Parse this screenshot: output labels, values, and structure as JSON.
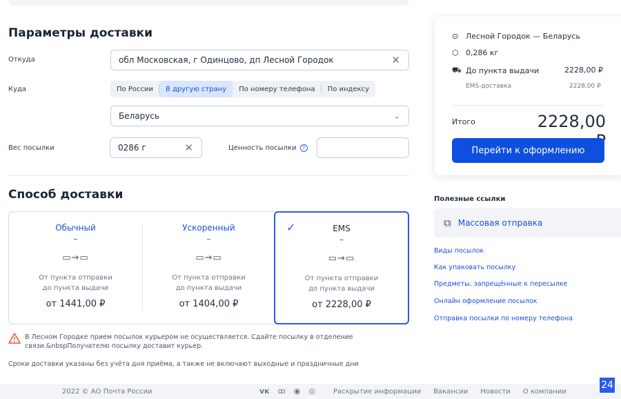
{
  "delivery_params": {
    "title": "Параметры доставки",
    "from_label": "Откуда",
    "from_value": "обл Московская, г Одинцово, дп Лесной Городок",
    "to_label": "Куда",
    "to_options": [
      "По России",
      "В другую страну",
      "По номеру телефона",
      "По индексу"
    ],
    "to_selected": "В другую страну",
    "country": "Беларусь",
    "weight_label": "Вес посылки",
    "weight_value": "0286 г",
    "value_label": "Ценность посылки",
    "value_value": ""
  },
  "method": {
    "title": "Способ доставки",
    "options": [
      {
        "name": "Обычный",
        "dash": "–",
        "route": "▭→▭",
        "desc1": "От пункта отправки",
        "desc2": "до пункта выдачи",
        "price": "от 1441,00 ₽"
      },
      {
        "name": "Ускоренный",
        "dash": "–",
        "route": "▭→▭",
        "desc1": "От пункта отправки",
        "desc2": "до пункта выдачи",
        "price": "от 1404,00 ₽"
      },
      {
        "name": "EMS",
        "dash": "–",
        "route": "▭→▭",
        "desc1": "От пункта отправки",
        "desc2": "до пункта выдачи",
        "price": "от 2228,00 ₽"
      }
    ],
    "selected": "EMS"
  },
  "warning": "В Лесном Городке прием посылок курьером не осуществляется. Сдайте посылку в отделение связи.&nbspПолучателю посылку доставит курьер.",
  "note": "Сроки доставки указаны без учёта дня приёма, а также не включают выходные и праздничные дни",
  "summary": {
    "route": "Лесной Городок — Беларусь",
    "weight": "0,286 кг",
    "to_point": "До пункта выдачи",
    "to_point_price": "2228,00 ₽",
    "service": "EMS-доставка",
    "service_price": "2228,00 ₽",
    "total_label": "Итого",
    "total_value": "2228,00 ₽",
    "cta": "Перейти к оформлению"
  },
  "useful": {
    "title": "Полезные ссылки",
    "mass": "Массовая отправка",
    "links": [
      "Виды посылок",
      "Как упаковать посылку",
      "Предметы, запрещённые к пересылке",
      "Онлайн оформление посылок",
      "Отправка посылки по номеру телефона"
    ]
  },
  "footer": {
    "copyright": "2022 © АО Почта России",
    "links": [
      "Раскрытие информации",
      "Вакансии",
      "Новости",
      "О компании"
    ]
  },
  "badge": "24",
  "colors": {
    "accent": "#0f4fe0",
    "selected_border": "#2b5be8",
    "warning": "#e8552d"
  }
}
